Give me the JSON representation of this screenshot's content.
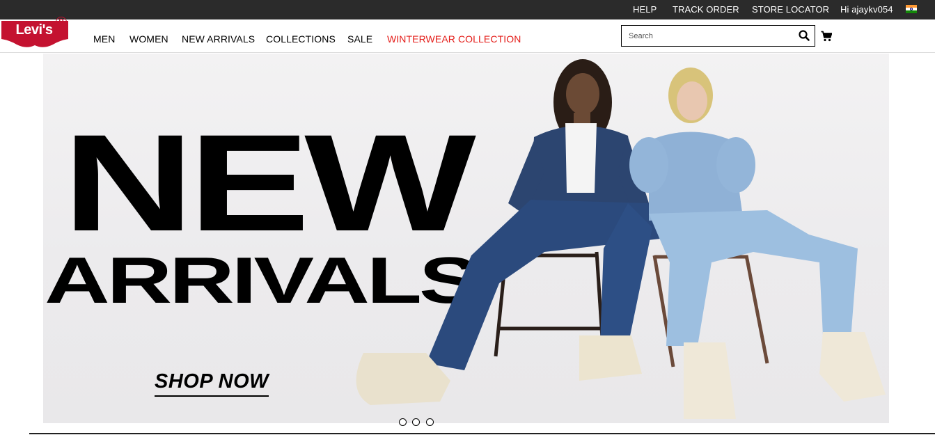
{
  "topbar": {
    "help": "HELP",
    "track_order": "TRACK ORDER",
    "store_locator": "STORE LOCATOR",
    "greeting": "Hi ajaykv054",
    "country_flag": "india-flag-icon"
  },
  "brand": {
    "logo_text": "Levi's",
    "registered_mark": "R",
    "brand_color": "#c41230"
  },
  "nav": {
    "items": [
      {
        "label": "MEN"
      },
      {
        "label": "WOMEN"
      },
      {
        "label": "NEW ARRIVALS"
      },
      {
        "label": "COLLECTIONS"
      },
      {
        "label": "SALE"
      },
      {
        "label": "WINTERWEAR COLLECTION",
        "color": "#e41b17"
      }
    ]
  },
  "search": {
    "placeholder": "Search",
    "value": ""
  },
  "icons": {
    "search": "search-icon",
    "cart": "cart-icon"
  },
  "hero": {
    "headline_line1": "NEW",
    "headline_line2": "ARRIVALS",
    "cta": "SHOP NOW",
    "image": "two models in denim seated on folding chairs"
  },
  "carousel": {
    "slide_count": 3
  },
  "colors": {
    "topbar_bg": "#2b2b2b",
    "accent_red": "#e41b17"
  }
}
